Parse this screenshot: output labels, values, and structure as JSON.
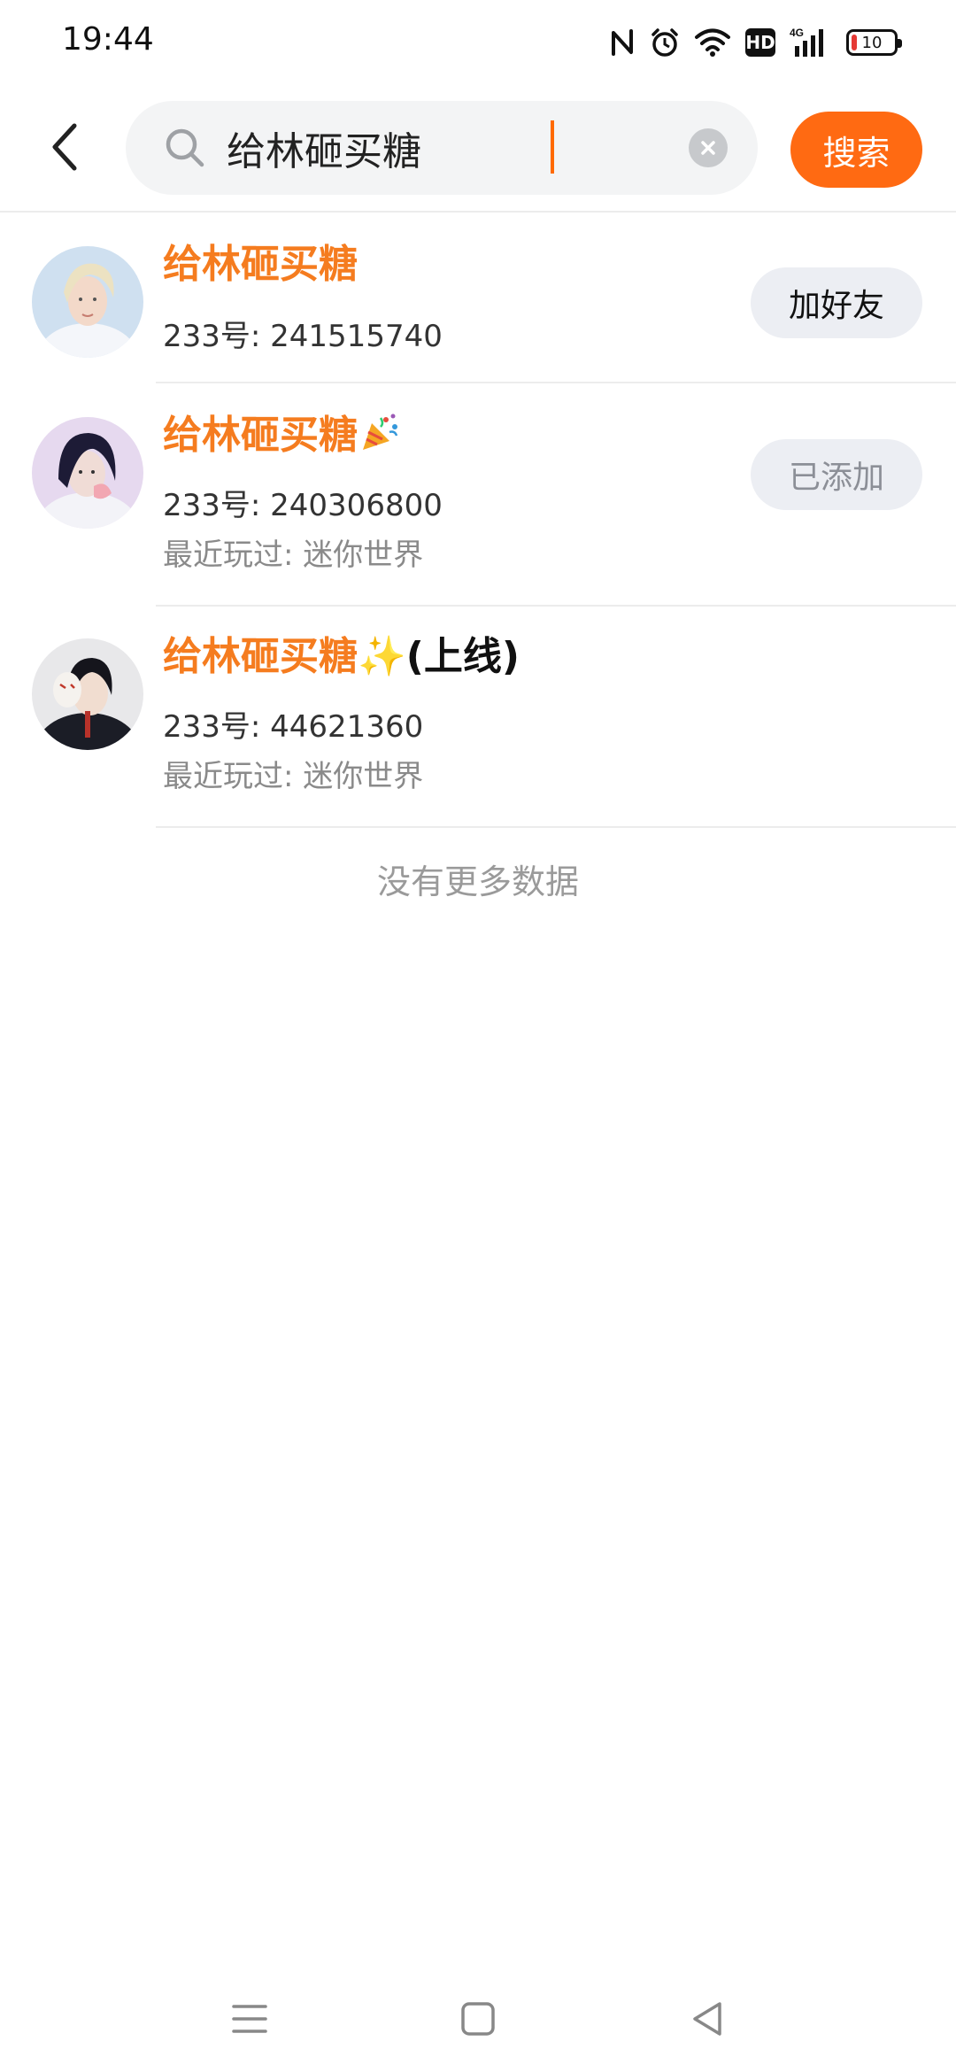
{
  "status_bar": {
    "time": "19:44",
    "icons": [
      "nfc-icon",
      "alarm-icon",
      "wifi-icon",
      "hd-icon",
      "4g-signal-icon",
      "battery-icon"
    ],
    "hd_label": "HD",
    "network_label": "4G",
    "battery_level": "10"
  },
  "search": {
    "query": "给林砸买糖",
    "button_label": "搜索"
  },
  "results": [
    {
      "name": "给林砸买糖",
      "name_suffix": "",
      "uid": "233号: 241515740",
      "recent": "",
      "action": "加好友",
      "action_state": "active"
    },
    {
      "name": "给林砸买糖",
      "name_suffix": "🎉",
      "uid": "233号: 240306800",
      "recent": "最近玩过: 迷你世界",
      "action": "已添加",
      "action_state": "disabled"
    },
    {
      "name": "给林砸买糖",
      "name_suffix": "✨(上线)",
      "uid": "233号: 44621360",
      "recent": "最近玩过: 迷你世界",
      "action": "",
      "action_state": "none"
    }
  ],
  "footer": {
    "no_more": "没有更多数据"
  },
  "colors": {
    "accent": "#ff6a12",
    "name_orange": "#f57c1f",
    "button_bg": "#eceef3"
  }
}
